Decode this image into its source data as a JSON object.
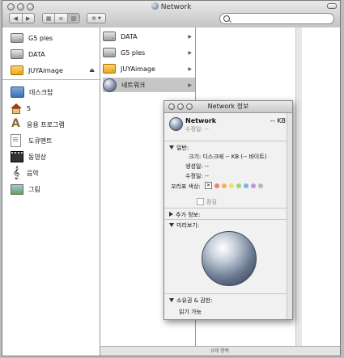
{
  "window": {
    "title": "Network"
  },
  "toolbar": {
    "back_icon": "back-arrow-icon",
    "forward_icon": "forward-arrow-icon",
    "view_icons": [
      "icon-view-icon",
      "list-view-icon",
      "column-view-icon"
    ],
    "action_icon": "gear-icon",
    "search_value": ""
  },
  "sidebar": {
    "devices": [
      {
        "label": "G5 ples",
        "icon": "hard-disk-icon"
      },
      {
        "label": "DATA",
        "icon": "hard-disk-icon"
      },
      {
        "label": "JUYAimage",
        "icon": "external-disk-icon",
        "eject": "⏏"
      }
    ],
    "places": [
      {
        "label": "데스크탑",
        "icon": "desktop-icon"
      },
      {
        "label": "5",
        "icon": "home-icon"
      },
      {
        "label": "응용 프로그램",
        "icon": "applications-icon"
      },
      {
        "label": "도큐멘트",
        "icon": "documents-icon"
      },
      {
        "label": "동영상",
        "icon": "movies-icon"
      },
      {
        "label": "음악",
        "icon": "music-icon"
      },
      {
        "label": "그림",
        "icon": "pictures-icon"
      }
    ]
  },
  "column1": {
    "items": [
      {
        "label": "DATA",
        "icon": "hard-disk-icon"
      },
      {
        "label": "G5 ples",
        "icon": "hard-disk-icon"
      },
      {
        "label": "JUYAimage",
        "icon": "external-disk-icon"
      },
      {
        "label": "네트워크",
        "icon": "network-globe-icon",
        "selected": true
      }
    ]
  },
  "status_bar": {
    "text": "0개 항목"
  },
  "info_panel": {
    "title": "Network 정보",
    "name": "Network",
    "size": "-- KB",
    "modified_short": "수정일: --",
    "general_label": "일반:",
    "kind_label": "크기:",
    "kind_value": "디스크에 -- KB (-- 바이트)",
    "created_label": "생성일:",
    "created_value": "--",
    "modified_label": "수정일:",
    "modified_value": "--",
    "label_color_label": "꼬리표 색상:",
    "label_colors": [
      "#f27d6f",
      "#f2b25a",
      "#f0e06a",
      "#9ad67a",
      "#7cb3ef",
      "#c395e0",
      "#b8b8b8"
    ],
    "locked_label": "잠김",
    "more_info_label": "추가 정보:",
    "preview_label": "미리보기:",
    "ownership_label": "소유권 & 권한:",
    "permission_value": "읽기 가능"
  }
}
